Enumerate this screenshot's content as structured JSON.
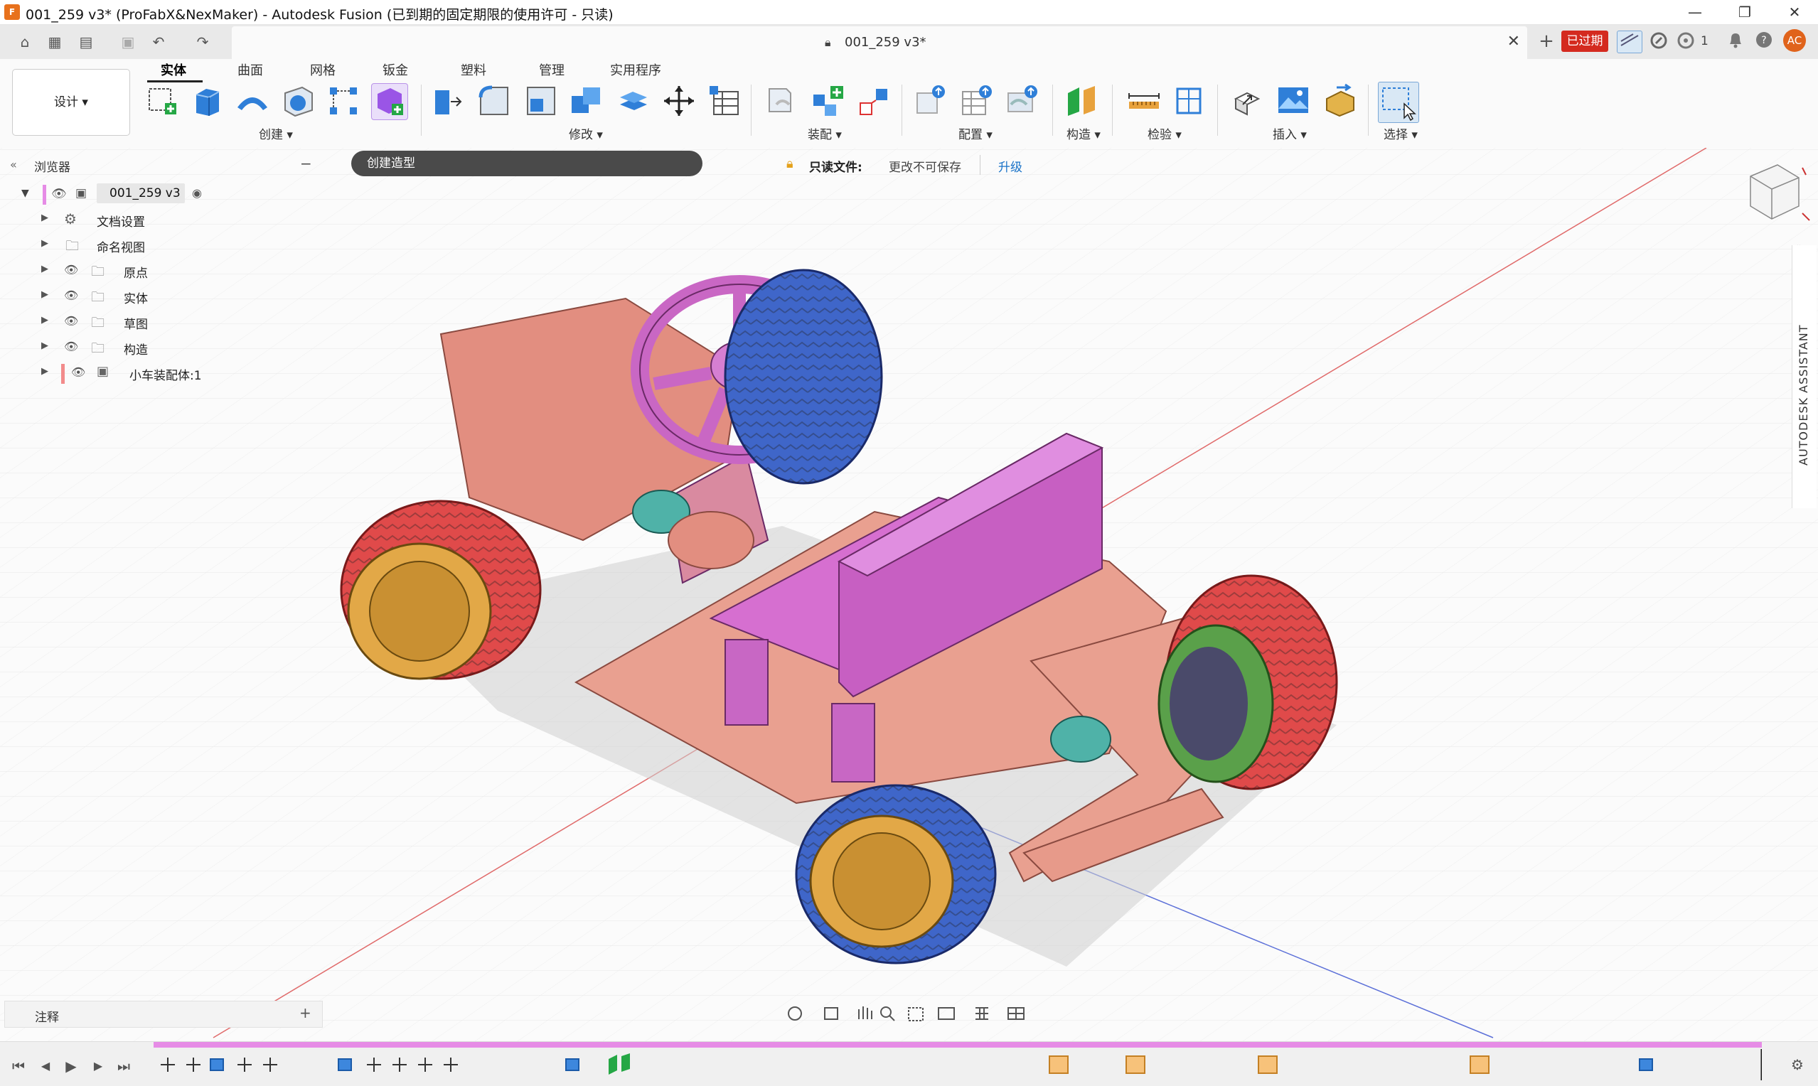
{
  "window": {
    "title": "001_259 v3* (ProFabX&NexMaker) - Autodesk Fusion (已到期的固定期限的使用许可 - 只读)",
    "app_icon_text": "F",
    "minimize": "—",
    "restore": "❐",
    "close": "✕"
  },
  "quick_access": {
    "home_icon": "⌂",
    "grid_icon": "▦",
    "file_icon": "▤",
    "save_icon": "▣",
    "undo_icon": "↶",
    "redo_icon": "↷"
  },
  "document_tab": {
    "label": "001_259 v3*",
    "lock_icon": "🔒",
    "close": "✕"
  },
  "right_tools": {
    "add": "+",
    "expired": "已过期",
    "job_count": "1",
    "avatar": "AC"
  },
  "ribbon": {
    "workspace": "设计 ▾",
    "tabs": [
      "实体",
      "曲面",
      "网格",
      "钣金",
      "塑料",
      "管理",
      "实用程序"
    ],
    "active_tab": "实体",
    "groups": [
      "创建 ▾",
      "修改 ▾",
      "装配 ▾",
      "配置 ▾",
      "构造 ▾",
      "检验 ▾",
      "插入 ▾",
      "选择 ▾"
    ]
  },
  "browser": {
    "title": "浏览器",
    "collapse": "−",
    "root": "001_259 v3",
    "items": [
      "文档设置",
      "命名视图",
      "原点",
      "实体",
      "草图",
      "构造",
      "小车装配体:1"
    ]
  },
  "tooltip": {
    "create_form": "创建造型"
  },
  "readonly_bar": {
    "label": "只读文件:",
    "message": "更改不可保存",
    "upgrade": "升级"
  },
  "assistant": {
    "label": "AUTODESK ASSISTANT",
    "collapse": "«"
  },
  "annotations": {
    "label": "注释",
    "add": "+"
  },
  "timeline": {
    "first": "⏮",
    "prev": "◀",
    "play": "▶",
    "next": "▶",
    "last": "⏭",
    "settings_icon": "⚙"
  },
  "colors": {
    "accent_red": "#d42a1f",
    "timeline_track": "#e68ce6",
    "avatar": "#e0631b",
    "tree_marker": "#e68ce6",
    "component_marker": "#f28b8b"
  }
}
